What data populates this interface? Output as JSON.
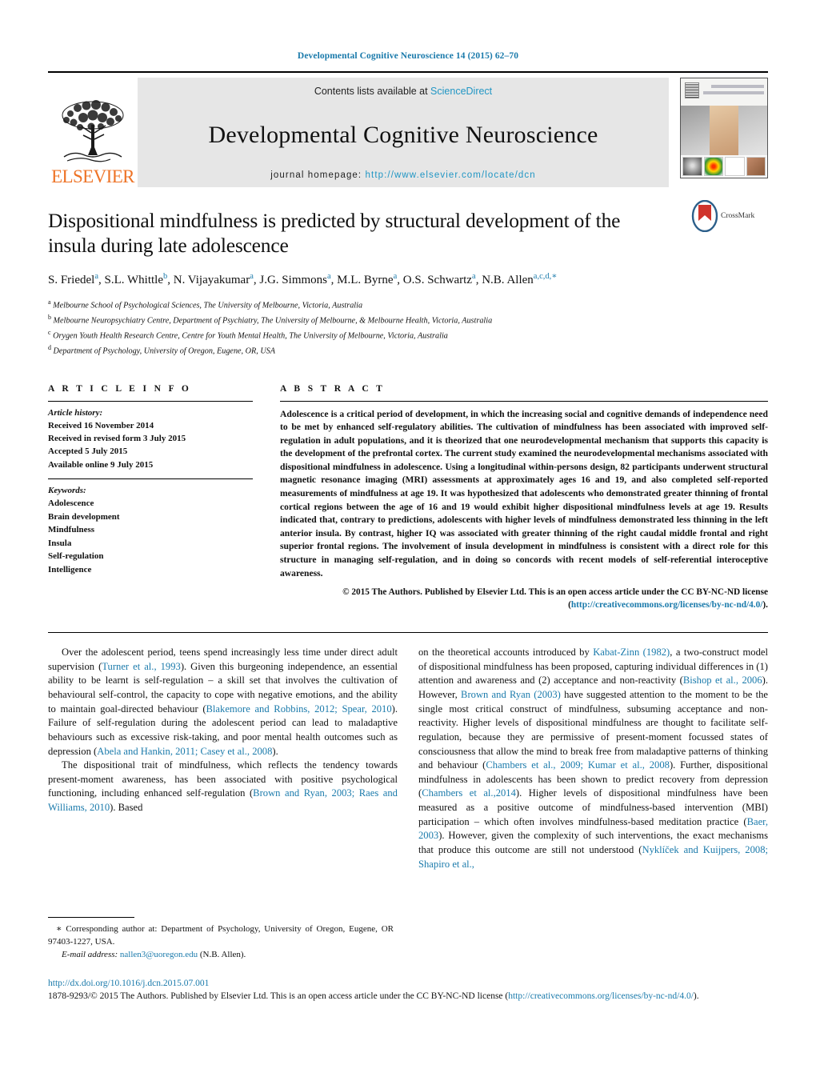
{
  "running_head": "Developmental Cognitive Neuroscience 14 (2015) 62–70",
  "masthead": {
    "publisher_name": "ELSEVIER",
    "contents_prefix": "Contents lists available at ",
    "sciencedirect": "ScienceDirect",
    "journal_title": "Developmental Cognitive Neuroscience",
    "homepage_label": "journal homepage:",
    "homepage_url": "http://www.elsevier.com/locate/dcn",
    "cover_title_line1": "Developmental",
    "cover_title_line2": "Cognitive Neuroscience"
  },
  "article": {
    "title": "Dispositional mindfulness is predicted by structural development of the insula during late adolescence",
    "crossmark_label": "CrossMark",
    "authors_html": "S. Friedel<sup>a</sup>, S.L. Whittle<sup>b</sup>, N. Vijayakumar<sup>a</sup>, J.G. Simmons<sup>a</sup>, M.L. Byrne<sup>a</sup>, O.S. Schwartz<sup>a</sup>, N.B. Allen<sup>a,c,d,</sup><sup>∗</sup>",
    "affiliations": [
      {
        "marker": "a",
        "text": "Melbourne School of Psychological Sciences, The University of Melbourne, Victoria, Australia"
      },
      {
        "marker": "b",
        "text": "Melbourne Neuropsychiatry Centre, Department of Psychiatry, The University of Melbourne, & Melbourne Health, Victoria, Australia"
      },
      {
        "marker": "c",
        "text": "Orygen Youth Health Research Centre, Centre for Youth Mental Health, The University of Melbourne, Victoria, Australia"
      },
      {
        "marker": "d",
        "text": "Department of Psychology, University of Oregon, Eugene, OR, USA"
      }
    ]
  },
  "article_info": {
    "heading": "A R T I C L E  I N F O",
    "history_label": "Article history:",
    "history": [
      "Received 16 November 2014",
      "Received in revised form 3 July 2015",
      "Accepted 5 July 2015",
      "Available online 9 July 2015"
    ],
    "keywords_label": "Keywords:",
    "keywords": [
      "Adolescence",
      "Brain development",
      "Mindfulness",
      "Insula",
      "Self-regulation",
      "Intelligence"
    ]
  },
  "abstract": {
    "heading": "A B S T R A C T",
    "text": "Adolescence is a critical period of development, in which the increasing social and cognitive demands of independence need to be met by enhanced self-regulatory abilities. The cultivation of mindfulness has been associated with improved self-regulation in adult populations, and it is theorized that one neurodevelopmental mechanism that supports this capacity is the development of the prefrontal cortex. The current study examined the neurodevelopmental mechanisms associated with dispositional mindfulness in adolescence. Using a longitudinal within-persons design, 82 participants underwent structural magnetic resonance imaging (MRI) assessments at approximately ages 16 and 19, and also completed self-reported measurements of mindfulness at age 19. It was hypothesized that adolescents who demonstrated greater thinning of frontal cortical regions between the age of 16 and 19 would exhibit higher dispositional mindfulness levels at age 19. Results indicated that, contrary to predictions, adolescents with higher levels of mindfulness demonstrated less thinning in the left anterior insula. By contrast, higher IQ was associated with greater thinning of the right caudal middle frontal and right superior frontal regions. The involvement of insula development in mindfulness is consistent with a direct role for this structure in managing self-regulation, and in doing so concords with recent models of self-referential interoceptive awareness.",
    "copyright_prefix": "© 2015 The Authors. Published by Elsevier Ltd. This is an open access article under the CC BY-NC-ND license (",
    "license_url": "http://creativecommons.org/licenses/by-nc-nd/4.0/",
    "copyright_suffix": ")."
  },
  "body": {
    "left_paragraphs": [
      {
        "runs": [
          {
            "t": "Over the adolescent period, teens spend increasingly less time under direct adult supervision ("
          },
          {
            "t": "Turner et al., 1993",
            "link": true
          },
          {
            "t": "). Given this burgeoning independence, an essential ability to be learnt is self-regulation – a skill set that involves the cultivation of behavioural self-control, the capacity to cope with negative emotions, and the ability to maintain goal-directed behaviour ("
          },
          {
            "t": "Blakemore and Robbins, 2012; Spear, 2010",
            "link": true
          },
          {
            "t": "). Failure of self-regulation during the adolescent period can lead to maladaptive behaviours such as excessive risk-taking, and poor mental health outcomes such as depression ("
          },
          {
            "t": "Abela and Hankin, 2011; Casey et al., 2008",
            "link": true
          },
          {
            "t": ")."
          }
        ]
      },
      {
        "runs": [
          {
            "t": "The dispositional trait of mindfulness, which reflects the tendency towards present-moment awareness, has been associated with positive psychological functioning, including enhanced self-regulation ("
          },
          {
            "t": "Brown and Ryan, 2003; Raes and Williams, 2010",
            "link": true
          },
          {
            "t": "). Based"
          }
        ]
      }
    ],
    "right_paragraphs": [
      {
        "runs": [
          {
            "t": "on the theoretical accounts introduced by "
          },
          {
            "t": "Kabat-Zinn (1982)",
            "link": true
          },
          {
            "t": ", a two-construct model of dispositional mindfulness has been proposed, capturing individual differences in (1) attention and awareness and (2) acceptance and non-reactivity ("
          },
          {
            "t": "Bishop et al., 2006",
            "link": true
          },
          {
            "t": "). However, "
          },
          {
            "t": "Brown and Ryan (2003)",
            "link": true
          },
          {
            "t": " have suggested attention to the moment to be the single most critical construct of mindfulness, subsuming acceptance and non-reactivity. Higher levels of dispositional mindfulness are thought to facilitate self-regulation, because they are permissive of present-moment focussed states of consciousness that allow the mind to break free from maladaptive patterns of thinking and behaviour ("
          },
          {
            "t": "Chambers et al., 2009; Kumar et al., 2008",
            "link": true
          },
          {
            "t": "). Further, dispositional mindfulness in adolescents has been shown to predict recovery from depression ("
          },
          {
            "t": "Chambers et al.,2014",
            "link": true
          },
          {
            "t": "). Higher levels of dispositional mindfulness have been measured as a positive outcome of mindfulness-based intervention (MBI) participation – which often involves mindfulness-based meditation practice ("
          },
          {
            "t": "Baer, 2003",
            "link": true
          },
          {
            "t": "). However, given the complexity of such interventions, the exact mechanisms that produce this outcome are still not understood ("
          },
          {
            "t": "Nyklíček and Kuijpers, 2008; Shapiro et al.,",
            "link": true
          }
        ]
      }
    ]
  },
  "footnote": {
    "star_text": "∗ Corresponding author at: Department of Psychology, University of Oregon, Eugene, OR 97403-1227, USA.",
    "email_label": "E-mail address:",
    "email": "nallen3@uoregon.edu",
    "email_attrib": "(N.B. Allen)."
  },
  "page_footer": {
    "doi": "http://dx.doi.org/10.1016/j.dcn.2015.07.001",
    "issn_prefix": "1878-9293/© 2015 The Authors. Published by Elsevier Ltd. This is an open access article under the CC BY-NC-ND license (",
    "issn_link": "http://creativecommons.org/licenses/by-nc-nd/4.0/",
    "issn_suffix": ")."
  },
  "colors": {
    "link": "#1a7aab",
    "sciencedirect": "#2196c4",
    "elsevier_orange": "#ee7326",
    "band_grey": "#e6e6e6"
  }
}
